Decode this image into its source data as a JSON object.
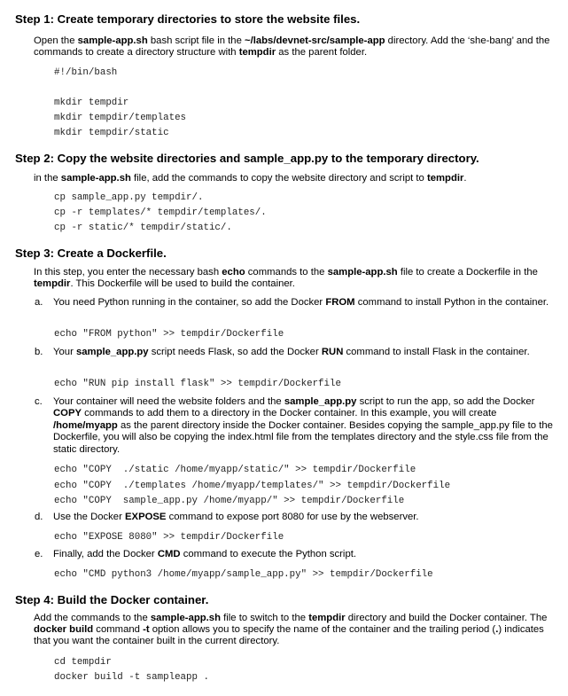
{
  "step1": {
    "heading": "Step 1: Create temporary directories to store the website files.",
    "para": [
      {
        "t": "Open the "
      },
      {
        "b": "sample-app.sh"
      },
      {
        "t": " bash script file in the "
      },
      {
        "b": "~/labs/devnet-src/sample-app"
      },
      {
        "t": " directory. Add the ‘she-bang’ and the commands to create a directory structure with "
      },
      {
        "b": "tempdir"
      },
      {
        "t": " as the parent folder."
      }
    ],
    "code": [
      "#!/bin/bash",
      "",
      "mkdir tempdir",
      "mkdir tempdir/templates",
      "mkdir tempdir/static"
    ]
  },
  "step2": {
    "heading": "Step 2: Copy the website directories and sample_app.py to the temporary directory.",
    "para": [
      {
        "t": "in the "
      },
      {
        "b": "sample-app.sh"
      },
      {
        "t": " file, add the commands to copy the website directory and script to "
      },
      {
        "b": "tempdir"
      },
      {
        "t": "."
      }
    ],
    "code": [
      "cp sample_app.py tempdir/.",
      "cp -r templates/* tempdir/templates/.",
      "cp -r static/* tempdir/static/."
    ]
  },
  "step3": {
    "heading": "Step 3: Create a Dockerfile.",
    "para": [
      {
        "t": "In this step, you enter the necessary bash "
      },
      {
        "b": "echo"
      },
      {
        "t": " commands to the "
      },
      {
        "b": "sample-app.sh"
      },
      {
        "t": " file to create a Dockerfile in the "
      },
      {
        "b": "tempdir"
      },
      {
        "t": ". This Dockerfile will be used to build the container."
      }
    ],
    "items": [
      {
        "letter": "a.",
        "text": [
          {
            "t": "You need Python running in the container, so add the Docker "
          },
          {
            "b": "FROM"
          },
          {
            "t": " command to install Python in the container."
          }
        ],
        "code": [
          "echo \"FROM python\" >> tempdir/Dockerfile"
        ]
      },
      {
        "letter": "b.",
        "text": [
          {
            "t": "Your "
          },
          {
            "b": "sample_app.py"
          },
          {
            "t": " script needs Flask, so add the Docker "
          },
          {
            "b": "RUN"
          },
          {
            "t": " command to install Flask in the container."
          }
        ],
        "code": [
          "echo \"RUN pip install flask\" >> tempdir/Dockerfile"
        ]
      },
      {
        "letter": "c.",
        "text": [
          {
            "t": "Your container will need the website folders and the "
          },
          {
            "b": "sample_app.py"
          },
          {
            "t": " script to run the app, so add the Docker "
          },
          {
            "b": "COPY"
          },
          {
            "t": " commands to add them to a directory in the Docker container. In this example, you will create "
          },
          {
            "b": "/home/myapp"
          },
          {
            "t": " as the parent directory inside the Docker container. Besides copying the sample_app.py file to the Dockerfile, you will also be copying the index.html file from the templates directory and the style.css file from the static directory."
          }
        ],
        "code": [
          "echo \"COPY  ./static /home/myapp/static/\" >> tempdir/Dockerfile",
          "echo \"COPY  ./templates /home/myapp/templates/\" >> tempdir/Dockerfile",
          "echo \"COPY  sample_app.py /home/myapp/\" >> tempdir/Dockerfile"
        ]
      },
      {
        "letter": "d.",
        "text": [
          {
            "t": "Use the Docker "
          },
          {
            "b": "EXPOSE"
          },
          {
            "t": " command to expose port 8080 for use by the webserver."
          }
        ],
        "code": [
          "echo \"EXPOSE 8080\" >> tempdir/Dockerfile"
        ]
      },
      {
        "letter": "e.",
        "text": [
          {
            "t": "Finally, add the Docker "
          },
          {
            "b": "CMD"
          },
          {
            "t": " command to execute the Python script."
          }
        ],
        "code": [
          "echo \"CMD python3 /home/myapp/sample_app.py\" >> tempdir/Dockerfile"
        ]
      }
    ]
  },
  "step4": {
    "heading": "Step 4: Build the Docker container.",
    "para": [
      {
        "t": "Add the commands to the "
      },
      {
        "b": "sample-app.sh"
      },
      {
        "t": " file to switch to the "
      },
      {
        "b": "tempdir"
      },
      {
        "t": " directory and build the Docker container. The "
      },
      {
        "b": "docker build"
      },
      {
        "t": " command "
      },
      {
        "b": "-t"
      },
      {
        "t": " option allows you to specify the name of the container and the trailing period ("
      },
      {
        "b": "."
      },
      {
        "t": ") indicates that you want the container built in the current directory."
      }
    ],
    "code": [
      "cd tempdir",
      "docker build -t sampleapp ."
    ]
  }
}
